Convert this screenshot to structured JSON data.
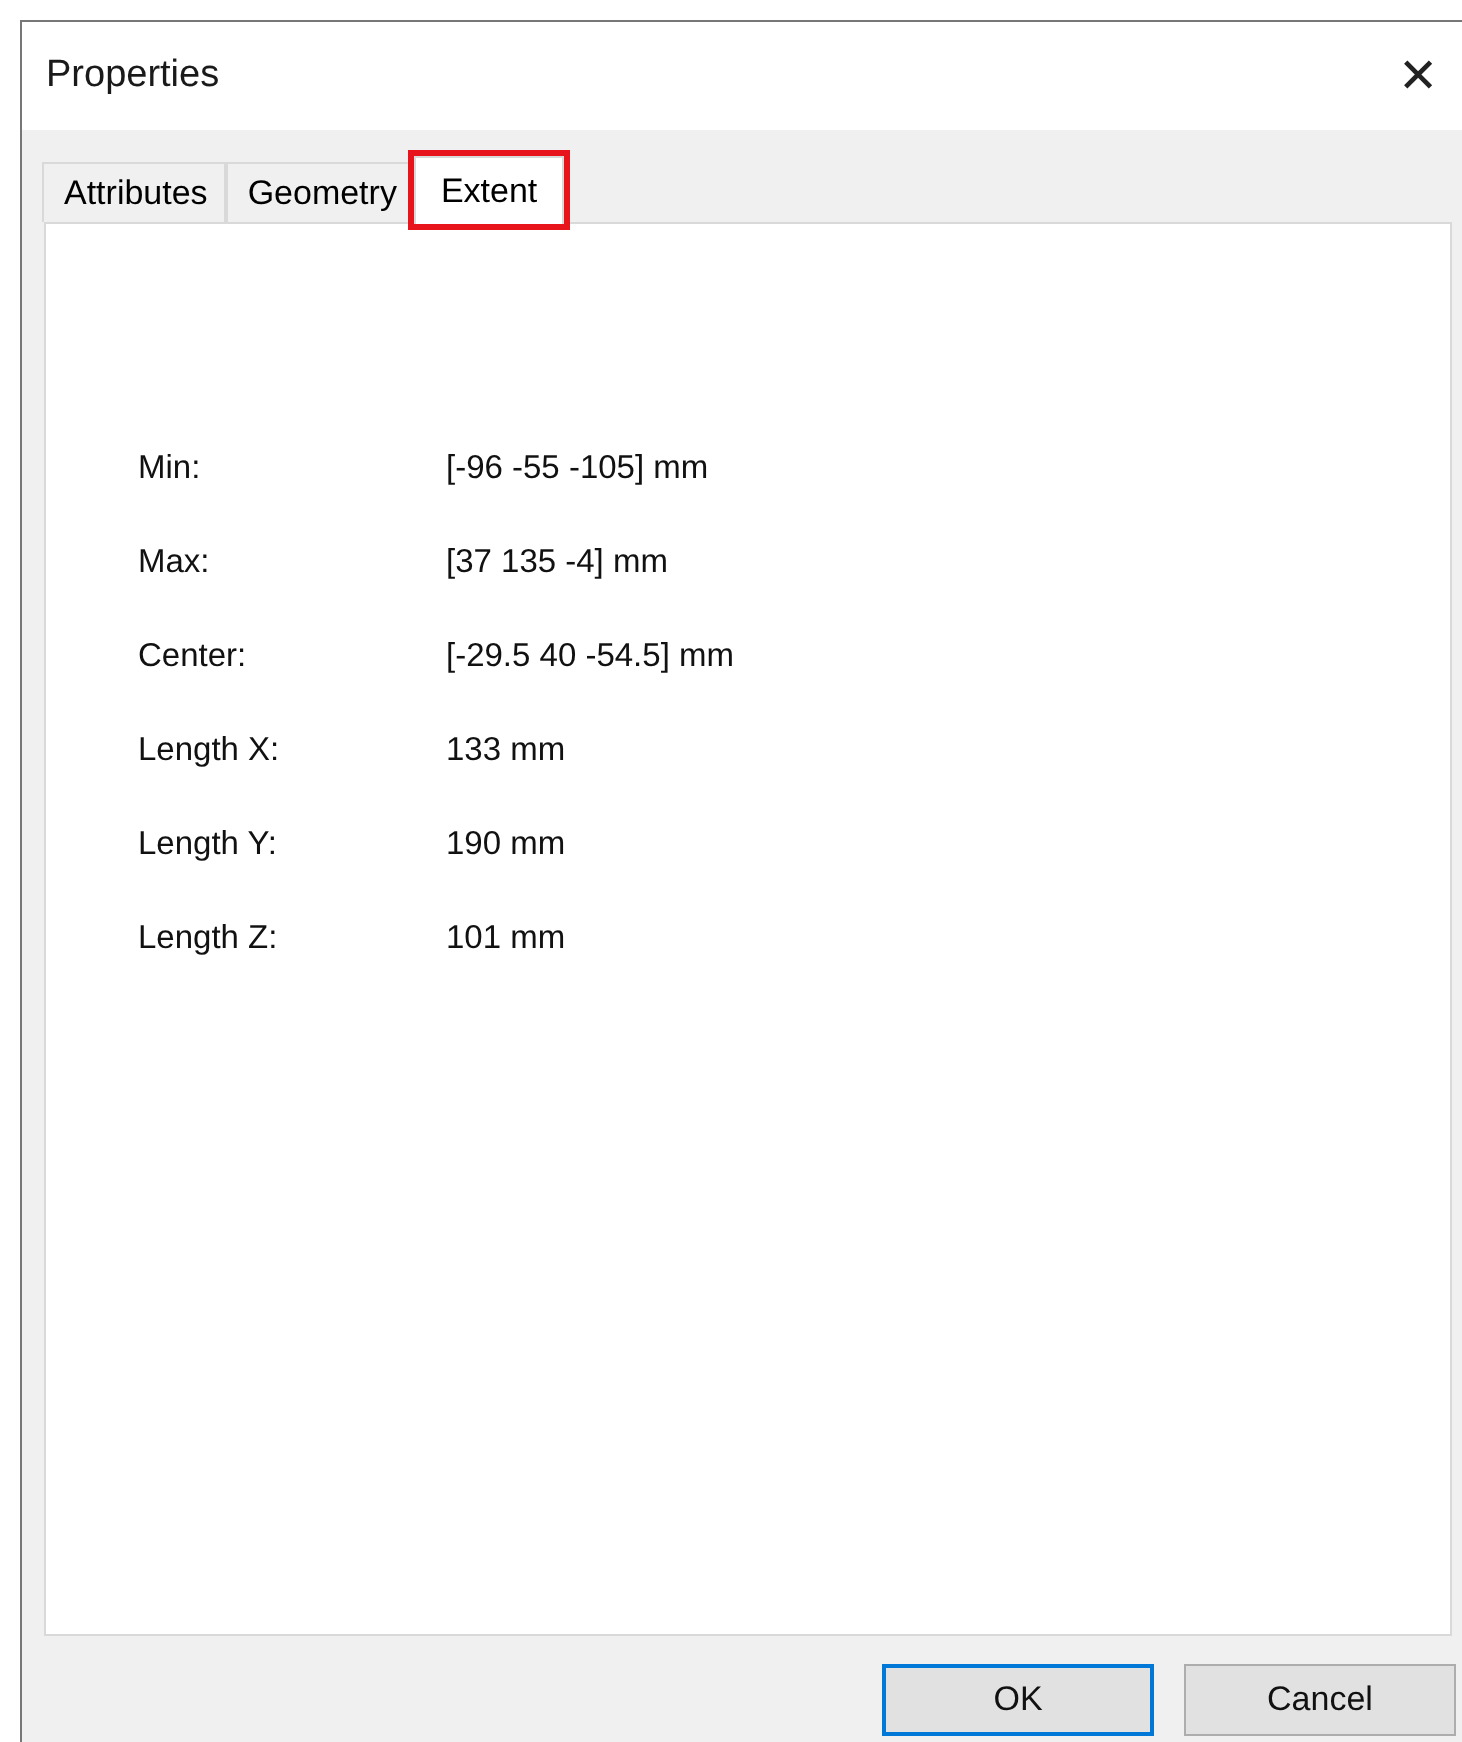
{
  "window": {
    "title": "Properties",
    "close": "✕"
  },
  "tabs": [
    {
      "label": "Attributes",
      "selected": false,
      "highlighted": false
    },
    {
      "label": "Geometry",
      "selected": false,
      "highlighted": false
    },
    {
      "label": "Extent",
      "selected": true,
      "highlighted": true
    }
  ],
  "fields": [
    {
      "label": "Min:",
      "value": "[-96 -55 -105] mm"
    },
    {
      "label": "Max:",
      "value": "[37 135 -4] mm"
    },
    {
      "label": "Center:",
      "value": "[-29.5 40 -54.5] mm"
    },
    {
      "label": "Length X:",
      "value": "133 mm"
    },
    {
      "label": "Length Y:",
      "value": "190 mm"
    },
    {
      "label": "Length Z:",
      "value": "101 mm"
    }
  ],
  "buttons": [
    {
      "label": "OK",
      "default": true
    },
    {
      "label": "Cancel",
      "default": false
    }
  ]
}
